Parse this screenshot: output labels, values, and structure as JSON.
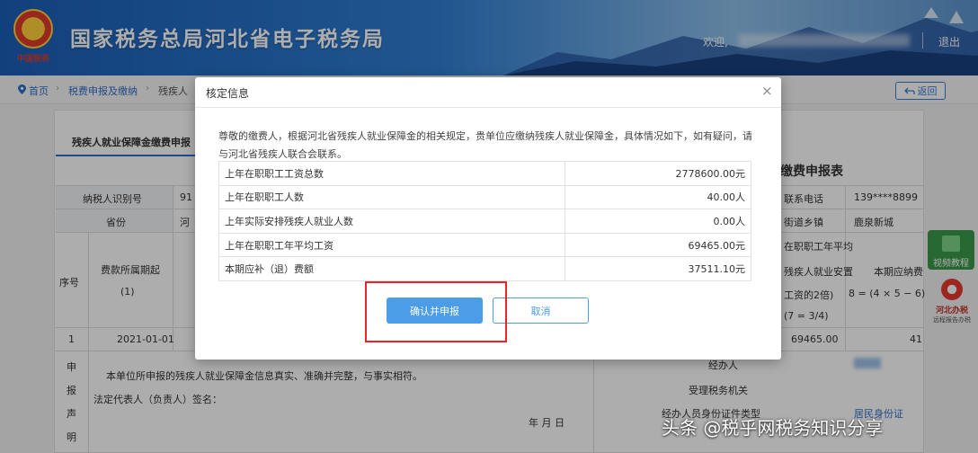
{
  "header": {
    "logo_text": "中国税务",
    "site_title": "国家税务总局河北省电子税务局",
    "welcome": "欢迎,",
    "logout": "退出"
  },
  "breadcrumb": {
    "home": "首页",
    "item1": "税费申报及缴纳",
    "item2": "残疾人"
  },
  "back_button": "返回",
  "page": {
    "tab": "残疾人就业保障金缴费申报",
    "title": "缴费申报表",
    "left_rows": {
      "taxpayer_id_label": "纳税人识别号",
      "taxpayer_id_value": "91",
      "province_label": "省份",
      "province_value": "河",
      "seq_header": "序号",
      "period_start_header": "费款所属期起",
      "period_start_sub": "(1)",
      "row1_seq": "1",
      "row1_start": "2021-01-01"
    },
    "right_rows": {
      "phone_label": "联系电话",
      "phone_value": "139****8899",
      "town_label": "街道乡镇",
      "town_value": "鹿泉新城",
      "avg_wage_header_1": "在职职工年平均",
      "avg_wage_header_2": "残疾人就业安置",
      "avg_wage_header_3": "工资的2倍)",
      "avg_wage_formula": "(7 = 3/4)",
      "payable_header": "本期应纳费",
      "payable_formula": "8 = (4 × 5 − 6)",
      "row1_avg": "69465.00",
      "row1_payable": "41"
    },
    "declaration": {
      "side_label": [
        "申",
        "报",
        "声",
        "明"
      ],
      "text": "本单位所申报的残疾人就业保障金信息真实、准确并完整，与事实相符。",
      "sign": "法定代表人（负责人）签名：",
      "date": "年    月    日",
      "agent_label": "经办人",
      "agency_label": "受理税务机关",
      "id_type_label": "经办人员身份证件类型",
      "id_type_value": "居民身份证"
    }
  },
  "sidebar_badges": {
    "video": "视频教程",
    "helper_title": "河北办税",
    "helper_sub": "远程报告办税"
  },
  "modal": {
    "title": "核定信息",
    "message": "尊敬的缴费人，根据河北省残疾人就业保障金的相关规定，贵单位应缴纳残疾人就业保障金，具体情况如下，如有疑问，请与河北省残疾人联合会联系。",
    "rows": [
      {
        "label": "上年在职职工工资总数",
        "value": "2778600.00元"
      },
      {
        "label": "上年在职职工人数",
        "value": "40.00人"
      },
      {
        "label": "上年实际安排残疾人就业人数",
        "value": "0.00人"
      },
      {
        "label": "上年在职职工年平均工资",
        "value": "69465.00元"
      },
      {
        "label": "本期应补（退）费额",
        "value": "37511.10元"
      }
    ],
    "confirm": "确认并申报",
    "cancel": "取消"
  },
  "watermark": "头条 @税乎网税务知识分享",
  "colors": {
    "header_blue": "#2f7fd4",
    "primary_button": "#4b9de8",
    "highlight_red": "#e8262a"
  }
}
